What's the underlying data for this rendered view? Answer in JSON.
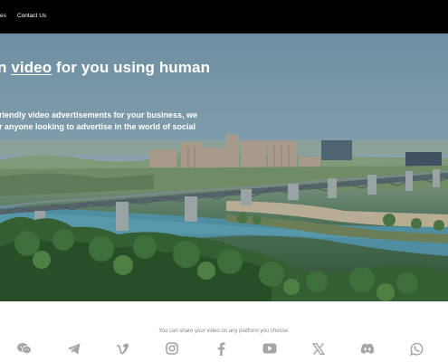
{
  "nav": {
    "partial_label": "es",
    "contact_label": "Contact Us"
  },
  "hero": {
    "title_before": "n ",
    "title_highlight": "video",
    "title_after": " for you using human",
    "body_line1": "riendly video advertisements for your business, we",
    "body_line2": "r anyone looking to advertise in the world of social"
  },
  "share": {
    "text": "You can share your video on any platform you choose."
  },
  "platforms": [
    {
      "icon": "wechat-icon"
    },
    {
      "icon": "telegram-icon"
    },
    {
      "icon": "vimeo-icon"
    },
    {
      "icon": "instagram-icon"
    },
    {
      "icon": "facebook-icon"
    },
    {
      "icon": "youtube-icon"
    },
    {
      "icon": "x-icon"
    },
    {
      "icon": "discord-icon"
    },
    {
      "icon": "whatsapp-icon"
    }
  ],
  "colors": {
    "topbar": "#000000",
    "icon": "#a6a6a6",
    "muted_text": "#888888"
  }
}
